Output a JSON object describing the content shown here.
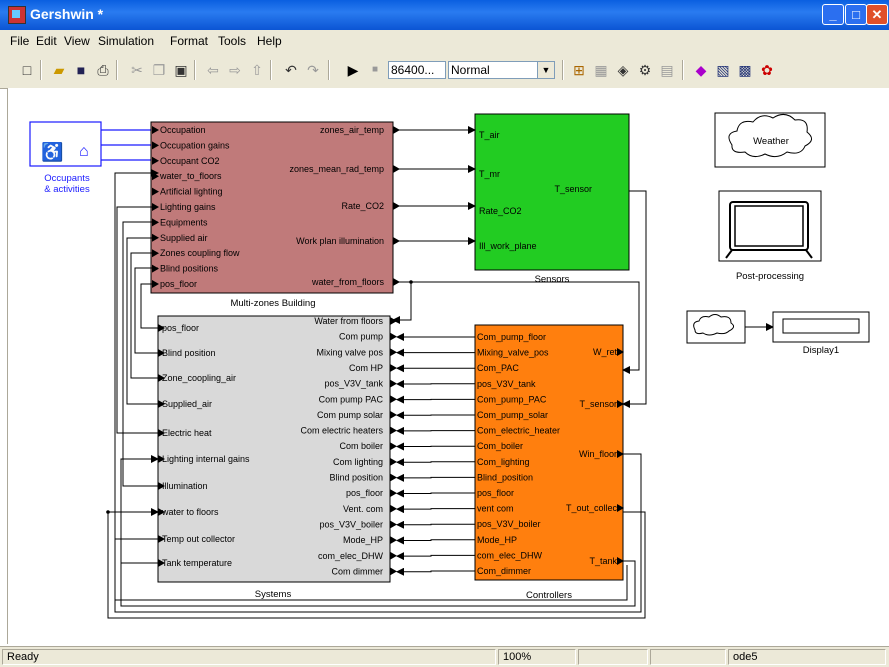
{
  "window": {
    "title": "Gershwin *"
  },
  "menu": [
    "File",
    "Edit",
    "View",
    "Simulation",
    "Format",
    "Tools",
    "Help"
  ],
  "toolbar": {
    "stop_time": "86400...",
    "sim_mode": "Normal"
  },
  "status": {
    "state": "Ready",
    "zoom": "100%",
    "solver": "ode5"
  },
  "blocks": {
    "occupants": {
      "label1": "Occupants",
      "label2": "& activities"
    },
    "building": {
      "title": "Multi-zones Building",
      "inputs": [
        "Occupation",
        "Occupation gains",
        "Occupant CO2",
        "water_to_floors",
        "Artificial lighting",
        "Lighting gains",
        "Equipments",
        "Supplied air",
        "Zones coupling flow",
        "Blind positions",
        "pos_floor"
      ],
      "outputs": [
        "zones_air_temp",
        "zones_mean_rad_temp",
        "Rate_CO2",
        "Work plan illumination",
        "water_from_floors"
      ],
      "color": "#c07a7a"
    },
    "sensors": {
      "title": "Sensors",
      "inputs": [
        "T_air",
        "T_mr",
        "Rate_CO2",
        "Ill_work_plane"
      ],
      "output": "T_sensor",
      "color": "#22cc22"
    },
    "weather": {
      "label": "Weather"
    },
    "postprocessing": {
      "label": "Post-processing"
    },
    "display": {
      "label": "Display1"
    },
    "systems": {
      "title": "Systems",
      "inputs": [
        "pos_floor",
        "Blind position",
        "Zone_coopling_air",
        "Supplied_air",
        "Electric heat",
        "Lighting internal gains",
        "Illumination",
        "water to floors",
        "Temp out collector",
        "Tank temperature"
      ],
      "outputs": [
        "Water from floors",
        "Com pump",
        "Mixing valve pos",
        "Com HP",
        "pos_V3V_tank",
        "Com pump PAC",
        "Com pump solar",
        "Com electric heaters",
        "Com boiler",
        "Com lighting",
        "Blind position",
        "pos_floor",
        "Vent. com",
        "pos_V3V_boiler",
        "Mode_HP",
        "com_elec_DHW",
        "Com dimmer"
      ],
      "color": "#d9d9d9"
    },
    "controllers": {
      "title": "Controllers",
      "inputs": [
        "Com_pump_floor",
        "Mixing_valve_pos",
        "Com_PAC",
        "pos_V3V_tank",
        "Com_pump_PAC",
        "Com_pump_solar",
        "Com_electric_heater",
        "Com_boiler",
        "Com_lighting",
        "Blind_position",
        "pos_floor",
        "vent com",
        "pos_V3V_boiler",
        "Mode_HP",
        "com_elec_DHW",
        "Com_dimmer"
      ],
      "outputs": [
        "W_ret",
        "T_sensor",
        "Win_floor",
        "T_out_collec",
        "T_tank"
      ],
      "color": "#ff7f0e"
    }
  }
}
